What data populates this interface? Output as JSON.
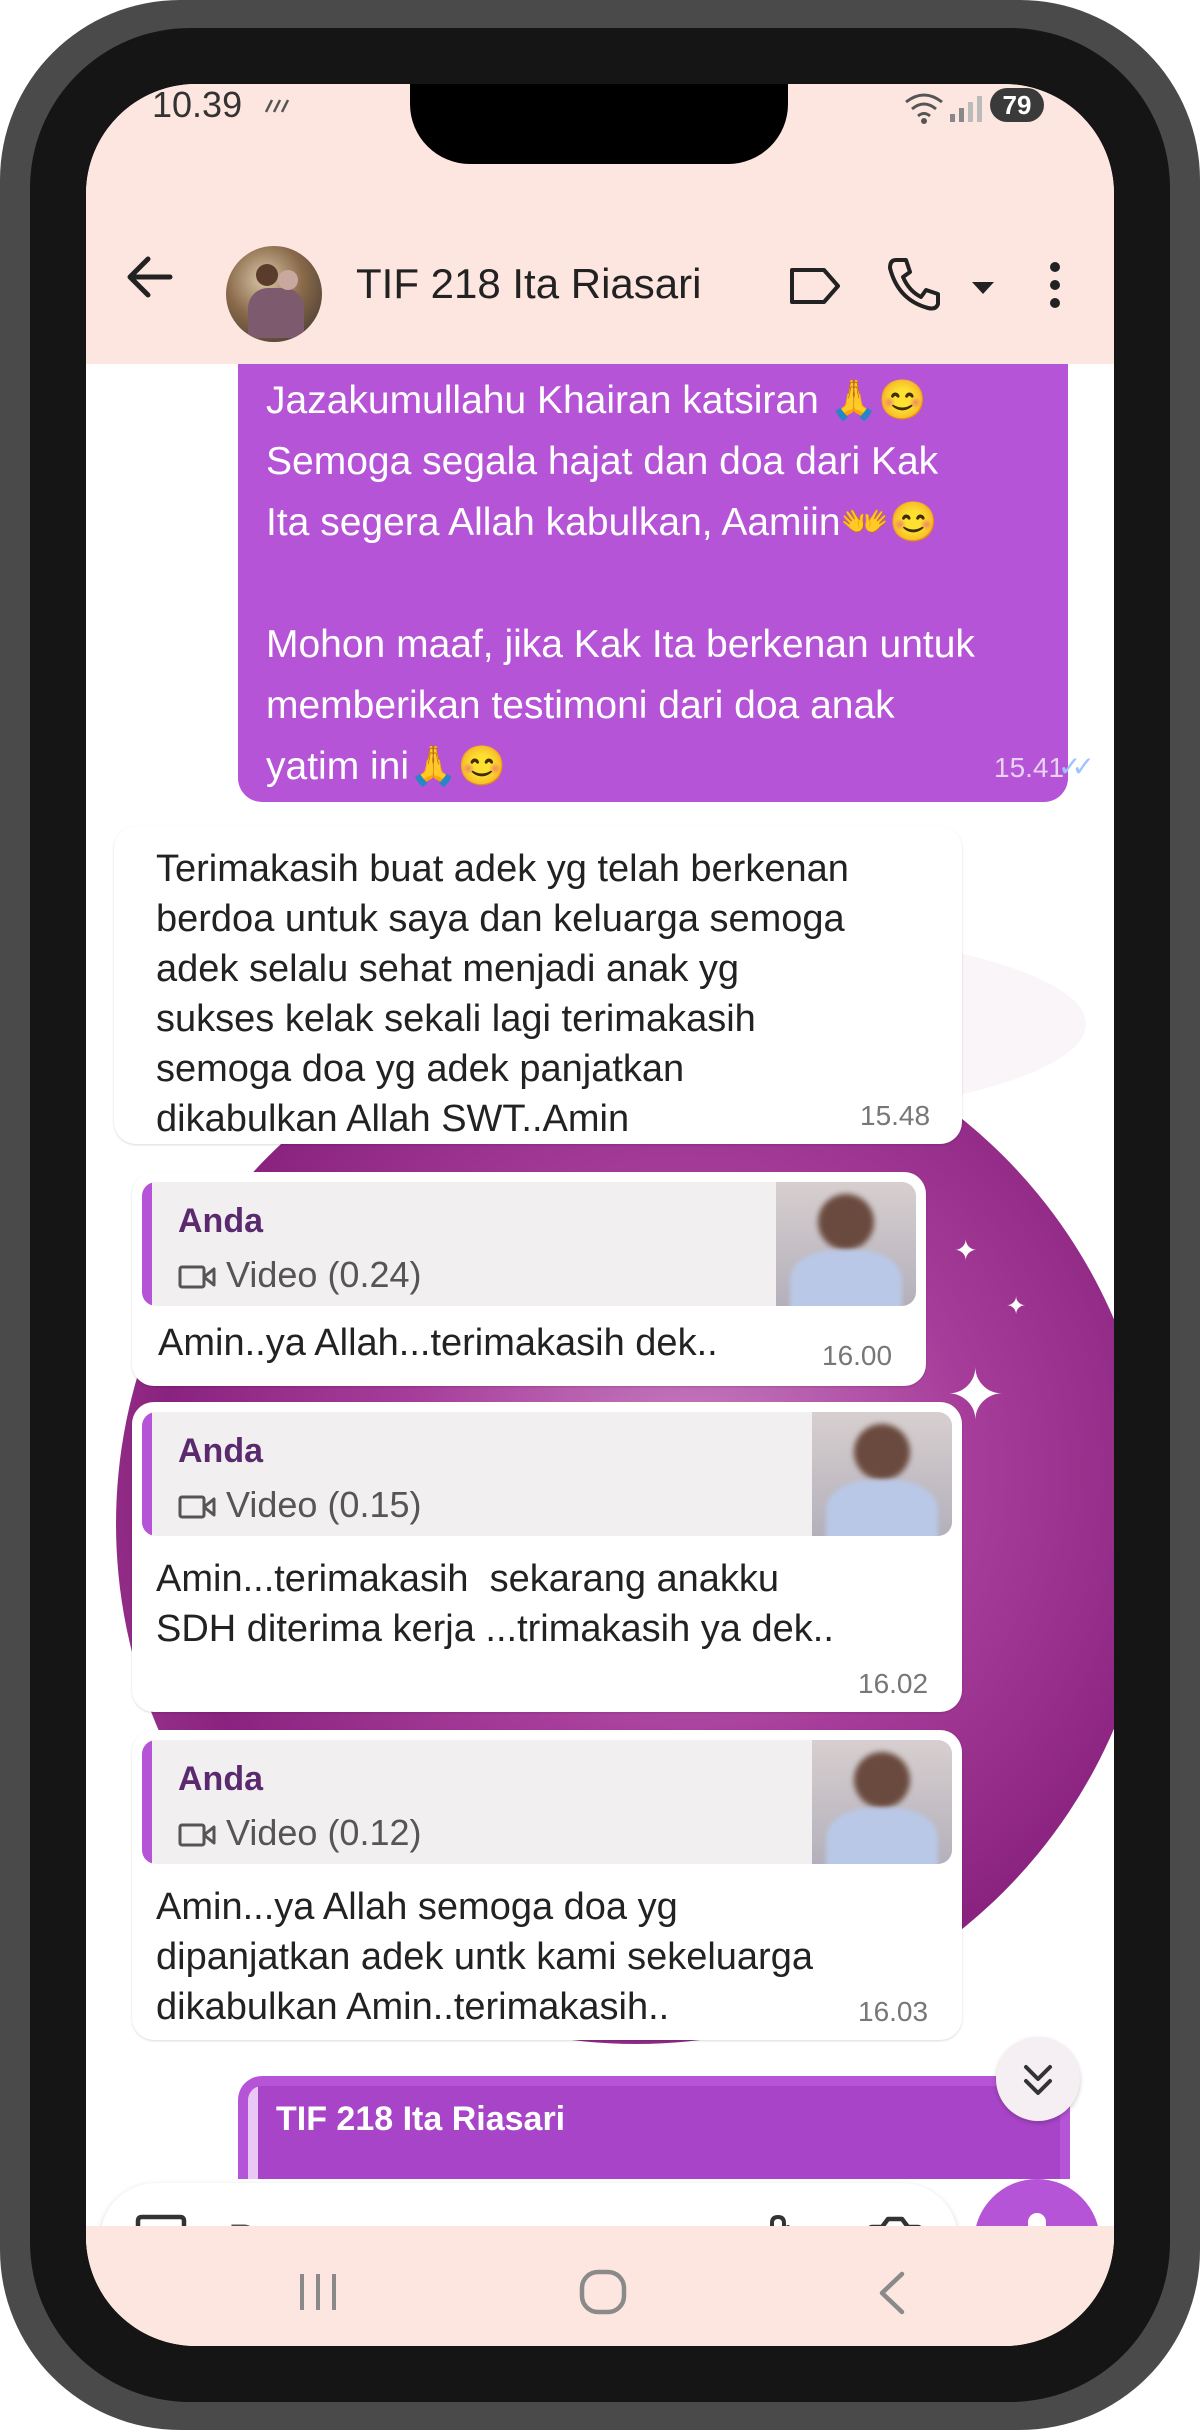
{
  "status_bar": {
    "time": "10.39",
    "battery": "79"
  },
  "header": {
    "title": "TIF 218 Ita Riasari"
  },
  "messages": [
    {
      "direction": "out",
      "text": "Jazakumullahu Khairan katsiran 🙏😊\nSemoga segala hajat dan doa dari Kak\nIta segera Allah kabulkan, Aamiin👐😊\n\nMohon maaf, jika Kak Ita berkenan untuk\nmemberikan testimoni dari doa anak\nyatim ini🙏😊",
      "time": "15.41",
      "ticks": "✓✓"
    },
    {
      "direction": "in",
      "text": "Terimakasih buat adek yg telah berkenan\nberdoa untuk saya dan keluarga semoga\nadek selalu sehat menjadi anak yg\nsukses kelak sekali lagi terimakasih\nsemoga doa yg adek panjatkan\ndikabulkan Allah SWT..Amin",
      "time": "15.48"
    },
    {
      "direction": "in",
      "quote_sender": "Anda",
      "quote_label": "Video (0.24)",
      "text": "Amin..ya Allah...terimakasih dek..",
      "time": "16.00"
    },
    {
      "direction": "in",
      "quote_sender": "Anda",
      "quote_label": "Video (0.15)",
      "text": "Amin...terimakasih  sekarang anakku\nSDH diterima kerja ...trimakasih ya dek..",
      "time": "16.02"
    },
    {
      "direction": "in",
      "quote_sender": "Anda",
      "quote_label": "Video (0.12)",
      "text": "Amin...ya Allah semoga doa yg\ndipanjatkan adek untk kami sekeluarga\ndikabulkan Amin..terimakasih..",
      "time": "16.03"
    },
    {
      "direction": "out",
      "quote_sender": "TIF 218 Ita Riasari"
    }
  ],
  "input": {
    "placeholder": "Pesan"
  },
  "icons": {
    "back": "arrow-left-icon",
    "label": "label-icon",
    "call": "phone-icon",
    "more": "kebab-menu-icon",
    "sticker": "sticker-icon",
    "attach": "paperclip-icon",
    "camera": "camera-icon",
    "mic": "mic-icon",
    "scroll": "chevron-double-down-icon",
    "video": "video-icon"
  },
  "colors": {
    "accent": "#b554d6",
    "header_bg": "#fde6e0",
    "quote_name": "#5b2a6e"
  }
}
